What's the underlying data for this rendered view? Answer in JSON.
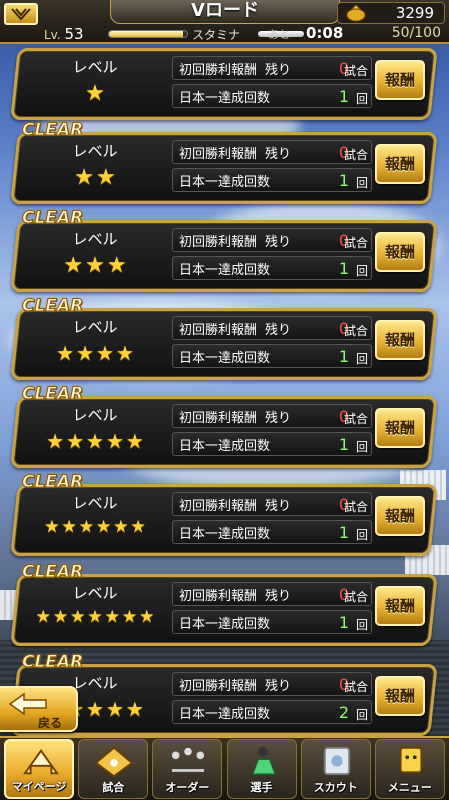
{
  "header": {
    "title": "Vロード",
    "level_prefix": "Lv.",
    "level": "53",
    "stamina_label": "スタミナ",
    "remaining_label": "あと",
    "timer": "0:08",
    "stamina_value": "50/100",
    "coins": "3299"
  },
  "stages": [
    {
      "clear": "",
      "level_label": "レベル",
      "stars": 1,
      "reward_label": "初回勝利報酬",
      "remain_label": "残り",
      "remain_value": "0",
      "remain_unit": "試合",
      "title_label": "日本一達成回数",
      "title_value": "1",
      "title_unit": "回",
      "button": "報酬"
    },
    {
      "clear": "CLEAR",
      "level_label": "レベル",
      "stars": 2,
      "reward_label": "初回勝利報酬",
      "remain_label": "残り",
      "remain_value": "0",
      "remain_unit": "試合",
      "title_label": "日本一達成回数",
      "title_value": "1",
      "title_unit": "回",
      "button": "報酬"
    },
    {
      "clear": "CLEAR",
      "level_label": "レベル",
      "stars": 3,
      "reward_label": "初回勝利報酬",
      "remain_label": "残り",
      "remain_value": "0",
      "remain_unit": "試合",
      "title_label": "日本一達成回数",
      "title_value": "1",
      "title_unit": "回",
      "button": "報酬"
    },
    {
      "clear": "CLEAR",
      "level_label": "レベル",
      "stars": 4,
      "reward_label": "初回勝利報酬",
      "remain_label": "残り",
      "remain_value": "0",
      "remain_unit": "試合",
      "title_label": "日本一達成回数",
      "title_value": "1",
      "title_unit": "回",
      "button": "報酬"
    },
    {
      "clear": "CLEAR",
      "level_label": "レベル",
      "stars": 5,
      "reward_label": "初回勝利報酬",
      "remain_label": "残り",
      "remain_value": "0",
      "remain_unit": "試合",
      "title_label": "日本一達成回数",
      "title_value": "1",
      "title_unit": "回",
      "button": "報酬"
    },
    {
      "clear": "CLEAR",
      "level_label": "レベル",
      "stars": 6,
      "reward_label": "初回勝利報酬",
      "remain_label": "残り",
      "remain_value": "0",
      "remain_unit": "試合",
      "title_label": "日本一達成回数",
      "title_value": "1",
      "title_unit": "回",
      "button": "報酬"
    },
    {
      "clear": "CLEAR",
      "level_label": "レベル",
      "stars": 7,
      "reward_label": "初回勝利報酬",
      "remain_label": "残り",
      "remain_value": "0",
      "remain_unit": "試合",
      "title_label": "日本一達成回数",
      "title_value": "1",
      "title_unit": "回",
      "button": "報酬"
    },
    {
      "clear": "CLEAR",
      "level_label": "レベル",
      "stars": 5,
      "reward_label": "初回勝利報酬",
      "remain_label": "残り",
      "remain_value": "0",
      "remain_unit": "試合",
      "title_label": "日本一達成回数",
      "title_value": "2",
      "title_unit": "回",
      "button": "報酬"
    }
  ],
  "back_button": {
    "label": "戻る"
  },
  "nav": [
    {
      "label": "マイページ",
      "icon": "home-icon",
      "active": true
    },
    {
      "label": "試合",
      "icon": "baseball-field-icon",
      "active": false
    },
    {
      "label": "オーダー",
      "icon": "lineup-icon",
      "active": false
    },
    {
      "label": "選手",
      "icon": "player-icon",
      "active": false
    },
    {
      "label": "スカウト",
      "icon": "scout-icon",
      "active": false
    },
    {
      "label": "メニュー",
      "icon": "menu-icon",
      "active": false
    }
  ],
  "colors": {
    "gold": "#c9a245",
    "red_value": "#ff4b4b",
    "green_value": "#8dff6a",
    "star": "#ffd23a"
  }
}
